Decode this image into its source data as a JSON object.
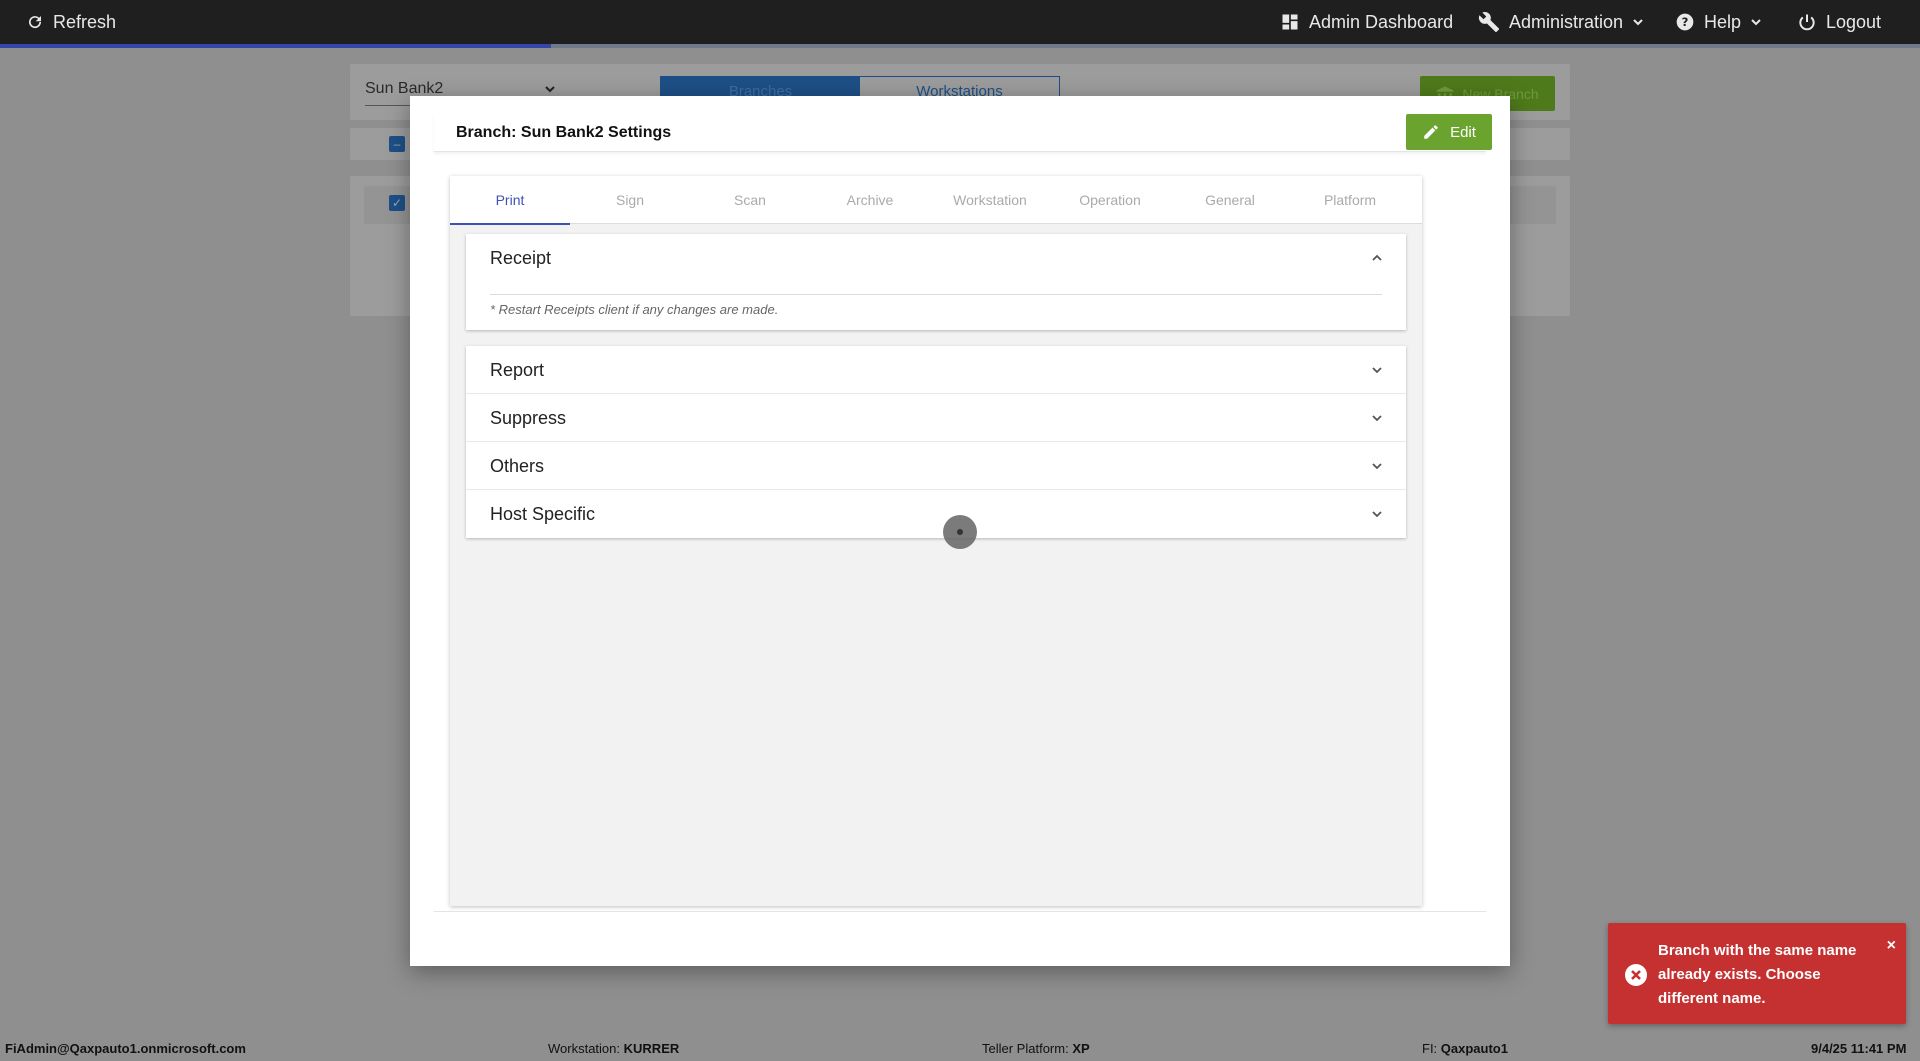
{
  "topbar": {
    "refresh_label": "Refresh",
    "admin_dashboard_label": "Admin Dashboard",
    "administration_label": "Administration",
    "help_label": "Help",
    "logout_label": "Logout",
    "progress_fraction": 0.287
  },
  "background": {
    "bank_select_value": "Sun Bank2",
    "tabs": [
      "Branches",
      "Workstations"
    ],
    "new_branch_label": "New Branch"
  },
  "modal": {
    "title": "Branch: Sun Bank2 Settings",
    "edit_label": "Edit",
    "tabs": [
      "Print",
      "Sign",
      "Scan",
      "Archive",
      "Workstation",
      "Operation",
      "General",
      "Platform"
    ],
    "active_tab": "Print",
    "receipt": {
      "label": "Receipt",
      "note": "* Restart Receipts client if any changes are made."
    },
    "sections": [
      "Report",
      "Suppress",
      "Others",
      "Host Specific"
    ]
  },
  "toast": {
    "message": "Branch with the same name already exists. Choose different name.",
    "close_label": "×"
  },
  "statusbar": {
    "user": "FiAdmin@Qaxpauto1.onmicrosoft.com",
    "workstation_label": "Workstation:",
    "workstation_value": "KURRER",
    "platform_label": "Teller Platform:",
    "platform_value": "XP",
    "fi_label": "FI:",
    "fi_value": "Qaxpauto1",
    "datetime": "9/4/25 11:41 PM"
  },
  "colors": {
    "topbar_bg": "#1f1f1f",
    "accent_blue": "#3f51b5",
    "edit_green": "#6aa42e",
    "toast_red": "#c53030",
    "overlay_bg": "#8f8f8f"
  }
}
